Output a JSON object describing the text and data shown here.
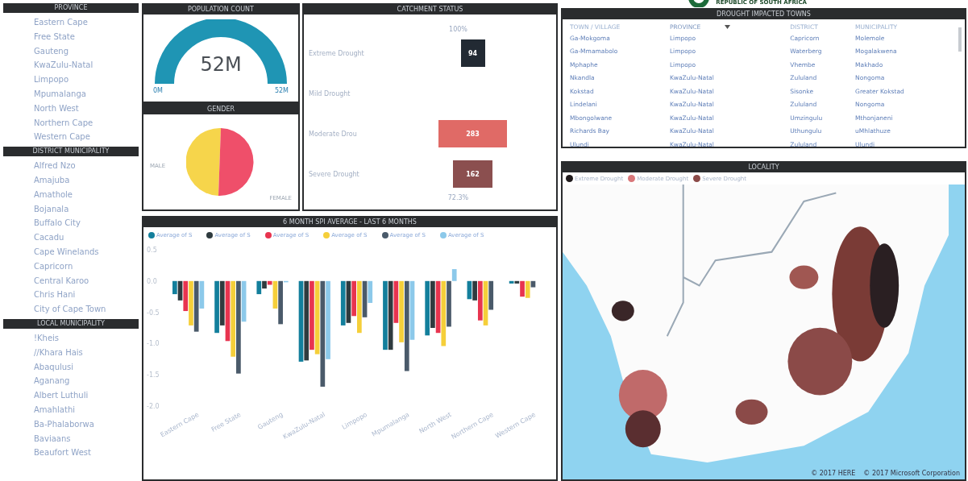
{
  "logo": {
    "text": "REPUBLIC OF SOUTH AFRICA"
  },
  "province_slicer": {
    "title": "PROVINCE",
    "items": [
      "Eastern Cape",
      "Free State",
      "Gauteng",
      "KwaZulu-Natal",
      "Limpopo",
      "Mpumalanga",
      "North West",
      "Northern Cape",
      "Western Cape"
    ]
  },
  "district_slicer": {
    "title": "DISTRICT MUNICIPALITY",
    "items": [
      "Alfred Nzo",
      "Amajuba",
      "Amathole",
      "Bojanala",
      "Buffalo City",
      "Cacadu",
      "Cape Winelands",
      "Capricorn",
      "Central Karoo",
      "Chris Hani",
      "City of Cape Town"
    ]
  },
  "local_slicer": {
    "title": "LOCAL MUNICIPALITY",
    "items": [
      "!Kheis",
      "//Khara Hais",
      "Abaqulusi",
      "Aganang",
      "Albert Luthuli",
      "Amahlathi",
      "Ba-Phalaborwa",
      "Baviaans",
      "Beaufort West"
    ]
  },
  "population": {
    "title": "POPULATION COUNT",
    "value": "52M",
    "min": "0M",
    "max": "52M"
  },
  "gender": {
    "title": "GENDER",
    "male_label": "MALE",
    "female_label": "FEMALE"
  },
  "catchment": {
    "title": "CATCHMENT STATUS",
    "top_label": "100%",
    "bottom_label": "72.3%",
    "stages": [
      {
        "label": "Extreme Drought",
        "value": "94",
        "color": "#222a33"
      },
      {
        "label": "Mild Drought"
      },
      {
        "label": "Moderate Drou",
        "value": "283",
        "color": "#e06a66"
      },
      {
        "label": "Severe Drought",
        "value": "162",
        "color": "#8b4f4f"
      }
    ]
  },
  "towns": {
    "title": "DROUGHT IMPACTED TOWNS",
    "columns": [
      {
        "label": "TOWN / VILLAGE",
        "sorted": false
      },
      {
        "label": "PROVINCE",
        "sorted": true
      },
      {
        "label": "DISTRICT",
        "sorted": false
      },
      {
        "label": "MUNICIPALITY",
        "sorted": false
      }
    ],
    "rows": [
      [
        "Ga-Mokgoma",
        "Limpopo",
        "Capricorn",
        "Molemole"
      ],
      [
        "Ga-Mmamabolo",
        "Limpopo",
        "Waterberg",
        "Mogalakwena"
      ],
      [
        "Mphaphe",
        "Limpopo",
        "Vhembe",
        "Makhado"
      ],
      [
        "Nkandla",
        "KwaZulu-Natal",
        "Zululand",
        "Nongoma"
      ],
      [
        "Kokstad",
        "KwaZulu-Natal",
        "Sisonke",
        "Greater Kokstad"
      ],
      [
        "Lindelani",
        "KwaZulu-Natal",
        "Zululand",
        "Nongoma"
      ],
      [
        "Mbongolwane",
        "KwaZulu-Natal",
        "Umzingulu",
        "Mthonjaneni"
      ],
      [
        "Richards Bay",
        "KwaZulu-Natal",
        "Uthungulu",
        "uMhlathuze"
      ],
      [
        "Ulundi",
        "KwaZulu-Natal",
        "Zululand",
        "Ulundi"
      ]
    ]
  },
  "spi": {
    "title": "6 MONTH SPI AVERAGE - LAST 6 MONTHS",
    "chart_data": {
      "type": "bar",
      "ylim": [
        -2,
        0.5
      ],
      "yticks": [
        {
          "value": 0.5,
          "label": "0.5"
        },
        {
          "value": 0,
          "label": "0.0"
        },
        {
          "value": -0.5,
          "label": "-0.5"
        },
        {
          "value": -1,
          "label": "-1.0"
        },
        {
          "value": -1.5,
          "label": "-1.5"
        },
        {
          "value": -2,
          "label": "-2.0"
        }
      ],
      "categories": [
        "Eastern Cape",
        "Free State",
        "Gauteng",
        "KwaZulu-Natal",
        "Limpopo",
        "Mpumalanga",
        "North West",
        "Northern Cape",
        "Western Cape"
      ],
      "series": [
        {
          "name": "Average of S",
          "color": "#137f9c",
          "values": [
            -0.21,
            -0.83,
            -0.21,
            -1.29,
            -0.71,
            -1.1,
            -0.87,
            -0.29,
            -0.04
          ]
        },
        {
          "name": "Average of S",
          "color": "#2f3b3f",
          "values": [
            -0.31,
            -0.71,
            -0.12,
            -1.27,
            -0.67,
            -1.1,
            -0.75,
            -0.31,
            -0.04
          ]
        },
        {
          "name": "Average of S",
          "color": "#e8344f",
          "values": [
            -0.48,
            -0.96,
            -0.06,
            -1.1,
            -0.56,
            -0.67,
            -0.83,
            -0.63,
            -0.25
          ]
        },
        {
          "name": "Average of S",
          "color": "#f5cf3a",
          "values": [
            -0.71,
            -1.21,
            -0.44,
            -1.17,
            -0.83,
            -0.98,
            -1.04,
            -0.71,
            -0.27
          ]
        },
        {
          "name": "Average of S",
          "color": "#4a5a6a",
          "values": [
            -0.81,
            -1.48,
            -0.69,
            -1.69,
            -0.58,
            -1.44,
            -0.73,
            -0.46,
            -0.1
          ]
        },
        {
          "name": "Average of S",
          "color": "#8cc9ea",
          "values": [
            -0.44,
            -0.65,
            -0.02,
            -1.25,
            -0.35,
            -0.94,
            0.19,
            null,
            null
          ]
        }
      ]
    }
  },
  "locality": {
    "title": "LOCALITY",
    "legend": [
      {
        "label": "Extreme Drought",
        "color": "#1f1a1c"
      },
      {
        "label": "Moderate Drought",
        "color": "#d9777a"
      },
      {
        "label": "Severe Drought",
        "color": "#8b4a48"
      }
    ],
    "attribution": [
      "© 2017 HERE",
      "© 2017 Microsoft Corporation"
    ]
  }
}
